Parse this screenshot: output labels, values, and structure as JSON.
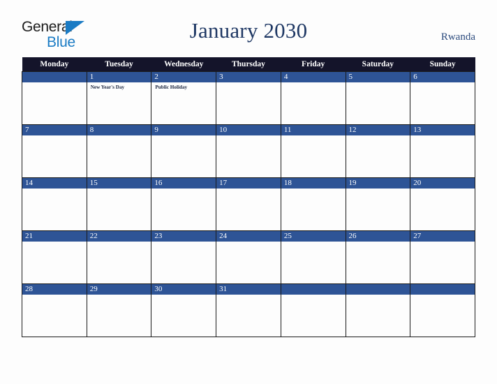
{
  "brand": {
    "name_line1": "General",
    "name_line2": "Blue",
    "triangle_color": "#1a7bc4"
  },
  "header": {
    "title": "January 2030",
    "country": "Rwanda",
    "title_color": "#1f3864",
    "country_color": "#2b4a7d"
  },
  "calendar": {
    "header_bg": "#14142a",
    "daybar_bg": "#2e5496",
    "weekdays": [
      "Monday",
      "Tuesday",
      "Wednesday",
      "Thursday",
      "Friday",
      "Saturday",
      "Sunday"
    ],
    "weeks": [
      [
        {
          "date": "",
          "events": []
        },
        {
          "date": "1",
          "events": [
            "New Year's Day"
          ]
        },
        {
          "date": "2",
          "events": [
            "Public Holiday"
          ]
        },
        {
          "date": "3",
          "events": []
        },
        {
          "date": "4",
          "events": []
        },
        {
          "date": "5",
          "events": []
        },
        {
          "date": "6",
          "events": []
        }
      ],
      [
        {
          "date": "7",
          "events": []
        },
        {
          "date": "8",
          "events": []
        },
        {
          "date": "9",
          "events": []
        },
        {
          "date": "10",
          "events": []
        },
        {
          "date": "11",
          "events": []
        },
        {
          "date": "12",
          "events": []
        },
        {
          "date": "13",
          "events": []
        }
      ],
      [
        {
          "date": "14",
          "events": []
        },
        {
          "date": "15",
          "events": []
        },
        {
          "date": "16",
          "events": []
        },
        {
          "date": "17",
          "events": []
        },
        {
          "date": "18",
          "events": []
        },
        {
          "date": "19",
          "events": []
        },
        {
          "date": "20",
          "events": []
        }
      ],
      [
        {
          "date": "21",
          "events": []
        },
        {
          "date": "22",
          "events": []
        },
        {
          "date": "23",
          "events": []
        },
        {
          "date": "24",
          "events": []
        },
        {
          "date": "25",
          "events": []
        },
        {
          "date": "26",
          "events": []
        },
        {
          "date": "27",
          "events": []
        }
      ],
      [
        {
          "date": "28",
          "events": []
        },
        {
          "date": "29",
          "events": []
        },
        {
          "date": "30",
          "events": []
        },
        {
          "date": "31",
          "events": []
        },
        {
          "date": "",
          "events": []
        },
        {
          "date": "",
          "events": []
        },
        {
          "date": "",
          "events": []
        }
      ]
    ]
  }
}
